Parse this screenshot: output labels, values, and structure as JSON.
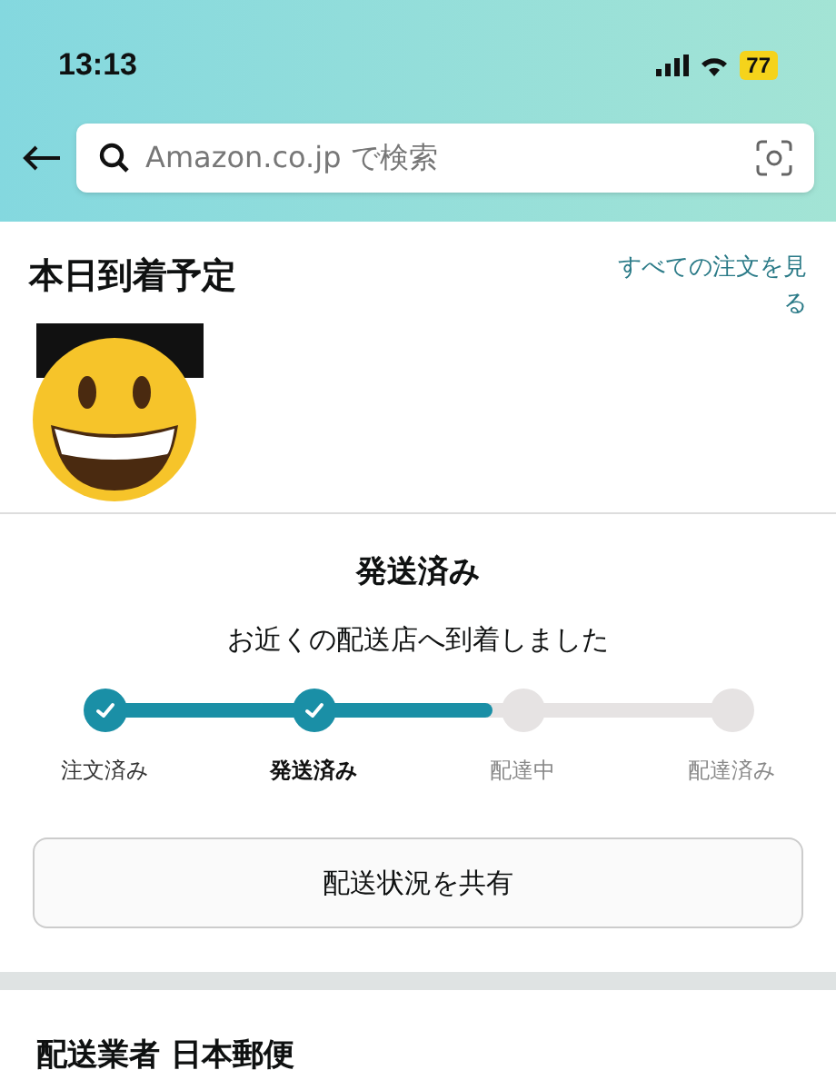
{
  "status_bar": {
    "time": "13:13",
    "battery": "77"
  },
  "search": {
    "placeholder": "Amazon.co.jp で検索"
  },
  "delivery": {
    "title": "本日到着予定",
    "all_orders_link": "すべての注文を見る"
  },
  "tracking": {
    "status": "発送済み",
    "message": "お近くの配送店へ到着しました",
    "level": 0.62,
    "steps": [
      {
        "label": "注文済み",
        "done": true,
        "selected": false
      },
      {
        "label": "発送済み",
        "done": true,
        "selected": true
      },
      {
        "label": "配達中",
        "done": false,
        "selected": false
      },
      {
        "label": "配達済み",
        "done": false,
        "selected": false
      }
    ],
    "share_button": "配送状況を共有"
  },
  "carrier": {
    "title": "配送業者 日本郵便"
  }
}
